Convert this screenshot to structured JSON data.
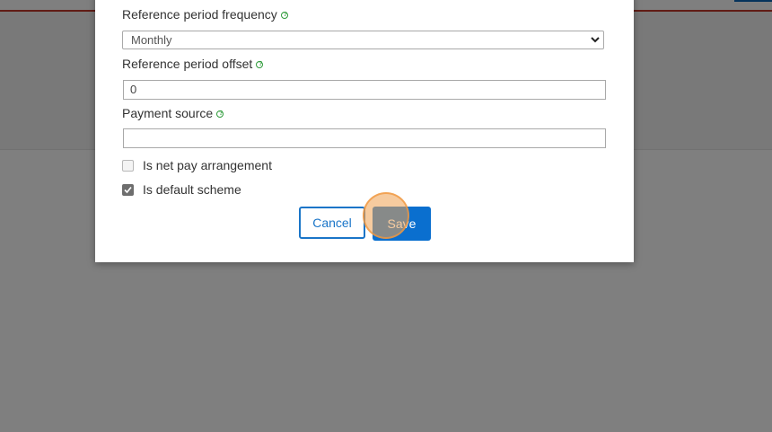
{
  "form": {
    "reference_period_frequency": {
      "label": "Reference period frequency",
      "help_icon": "help-circle-icon",
      "value": "Monthly"
    },
    "reference_period_offset": {
      "label": "Reference period offset",
      "help_icon": "help-circle-icon",
      "value": "0"
    },
    "payment_source": {
      "label": "Payment source",
      "help_icon": "help-circle-icon",
      "value": ""
    },
    "is_net_pay_arrangement": {
      "label": "Is net pay arrangement",
      "checked": false
    },
    "is_default_scheme": {
      "label": "Is default scheme",
      "checked": true
    }
  },
  "buttons": {
    "cancel_label": "Cancel",
    "save_label": "Save"
  },
  "colors": {
    "accent": "#0a6fcf",
    "help_icon": "#2e9b3a",
    "header_line": "#c0392b",
    "overlay": "#808080"
  }
}
